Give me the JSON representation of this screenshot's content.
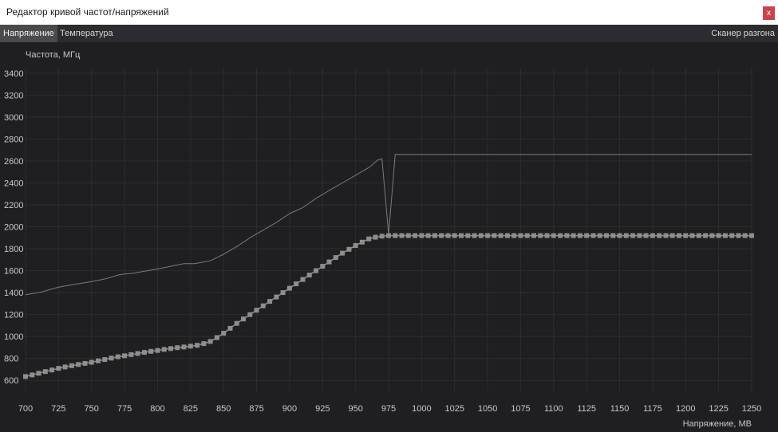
{
  "window": {
    "title": "Редактор кривой частот/напряжений",
    "close_label": "x"
  },
  "tabs": [
    {
      "label": "Напряжение",
      "active": true
    },
    {
      "label": "Температура",
      "active": false
    }
  ],
  "scanner_label": "Сканер разгона",
  "colors": {
    "background": "#1f1f21",
    "grid": "#2d2d30",
    "curve": "#8e8e8e",
    "max_line": "#7a7a7a",
    "tab_active": "#4a4a4e",
    "close": "#c8434f"
  },
  "chart_data": {
    "type": "line",
    "ylabel": "Частота, МГц",
    "xlabel": "Напряжение, МВ",
    "xlim": [
      700,
      1250
    ],
    "ylim": [
      500,
      3450
    ],
    "xticks": [
      700,
      725,
      750,
      775,
      800,
      825,
      850,
      875,
      900,
      925,
      950,
      975,
      1000,
      1025,
      1050,
      1075,
      1100,
      1125,
      1150,
      1175,
      1200,
      1225,
      1250
    ],
    "yticks": [
      600,
      800,
      1000,
      1200,
      1400,
      1600,
      1800,
      2000,
      2200,
      2400,
      2600,
      2800,
      3000,
      3200,
      3400
    ],
    "grid": true,
    "series": [
      {
        "role": "curve",
        "markers": "square",
        "points": [
          [
            700,
            635
          ],
          [
            705,
            650
          ],
          [
            710,
            665
          ],
          [
            715,
            680
          ],
          [
            720,
            695
          ],
          [
            725,
            710
          ],
          [
            730,
            722
          ],
          [
            735,
            734
          ],
          [
            740,
            745
          ],
          [
            745,
            755
          ],
          [
            750,
            765
          ],
          [
            755,
            778
          ],
          [
            760,
            790
          ],
          [
            765,
            803
          ],
          [
            770,
            815
          ],
          [
            775,
            825
          ],
          [
            780,
            835
          ],
          [
            785,
            845
          ],
          [
            790,
            855
          ],
          [
            795,
            865
          ],
          [
            800,
            873
          ],
          [
            805,
            882
          ],
          [
            810,
            890
          ],
          [
            815,
            898
          ],
          [
            820,
            905
          ],
          [
            825,
            912
          ],
          [
            830,
            920
          ],
          [
            835,
            935
          ],
          [
            840,
            955
          ],
          [
            845,
            990
          ],
          [
            850,
            1030
          ],
          [
            855,
            1075
          ],
          [
            860,
            1120
          ],
          [
            865,
            1160
          ],
          [
            870,
            1200
          ],
          [
            875,
            1240
          ],
          [
            880,
            1280
          ],
          [
            885,
            1320
          ],
          [
            890,
            1360
          ],
          [
            895,
            1400
          ],
          [
            900,
            1440
          ],
          [
            905,
            1480
          ],
          [
            910,
            1520
          ],
          [
            915,
            1560
          ],
          [
            920,
            1600
          ],
          [
            925,
            1640
          ],
          [
            930,
            1680
          ],
          [
            935,
            1720
          ],
          [
            940,
            1760
          ],
          [
            945,
            1795
          ],
          [
            950,
            1830
          ],
          [
            955,
            1860
          ],
          [
            960,
            1890
          ],
          [
            965,
            1905
          ],
          [
            970,
            1915
          ],
          [
            975,
            1920
          ],
          [
            980,
            1920
          ],
          [
            985,
            1920
          ],
          [
            990,
            1920
          ],
          [
            995,
            1920
          ],
          [
            1000,
            1920
          ],
          [
            1005,
            1920
          ],
          [
            1010,
            1920
          ],
          [
            1015,
            1920
          ],
          [
            1020,
            1920
          ],
          [
            1025,
            1920
          ],
          [
            1030,
            1920
          ],
          [
            1035,
            1920
          ],
          [
            1040,
            1920
          ],
          [
            1045,
            1920
          ],
          [
            1050,
            1920
          ],
          [
            1055,
            1920
          ],
          [
            1060,
            1920
          ],
          [
            1065,
            1920
          ],
          [
            1070,
            1920
          ],
          [
            1075,
            1920
          ],
          [
            1080,
            1920
          ],
          [
            1085,
            1920
          ],
          [
            1090,
            1920
          ],
          [
            1095,
            1920
          ],
          [
            1100,
            1920
          ],
          [
            1105,
            1920
          ],
          [
            1110,
            1920
          ],
          [
            1115,
            1920
          ],
          [
            1120,
            1920
          ],
          [
            1125,
            1920
          ],
          [
            1130,
            1920
          ],
          [
            1135,
            1920
          ],
          [
            1140,
            1920
          ],
          [
            1145,
            1920
          ],
          [
            1150,
            1920
          ],
          [
            1155,
            1920
          ],
          [
            1160,
            1920
          ],
          [
            1165,
            1920
          ],
          [
            1170,
            1920
          ],
          [
            1175,
            1920
          ],
          [
            1180,
            1920
          ],
          [
            1185,
            1920
          ],
          [
            1190,
            1920
          ],
          [
            1195,
            1920
          ],
          [
            1200,
            1920
          ],
          [
            1205,
            1920
          ],
          [
            1210,
            1920
          ],
          [
            1215,
            1920
          ],
          [
            1220,
            1920
          ],
          [
            1225,
            1920
          ],
          [
            1230,
            1920
          ],
          [
            1235,
            1920
          ],
          [
            1240,
            1920
          ],
          [
            1245,
            1920
          ],
          [
            1250,
            1920
          ]
        ]
      },
      {
        "role": "upper",
        "markers": "none",
        "points": [
          [
            700,
            1380
          ],
          [
            712,
            1405
          ],
          [
            725,
            1450
          ],
          [
            737,
            1475
          ],
          [
            750,
            1500
          ],
          [
            762,
            1530
          ],
          [
            770,
            1560
          ],
          [
            775,
            1570
          ],
          [
            780,
            1575
          ],
          [
            800,
            1615
          ],
          [
            820,
            1665
          ],
          [
            828,
            1665
          ],
          [
            840,
            1690
          ],
          [
            850,
            1750
          ],
          [
            860,
            1820
          ],
          [
            870,
            1900
          ],
          [
            880,
            1970
          ],
          [
            890,
            2040
          ],
          [
            900,
            2120
          ],
          [
            910,
            2175
          ],
          [
            920,
            2260
          ],
          [
            930,
            2330
          ],
          [
            940,
            2400
          ],
          [
            950,
            2470
          ],
          [
            960,
            2540
          ],
          [
            967,
            2610
          ],
          [
            970,
            2620
          ],
          [
            975,
            1930
          ],
          [
            980,
            2660
          ],
          [
            1250,
            2660
          ]
        ]
      }
    ]
  }
}
